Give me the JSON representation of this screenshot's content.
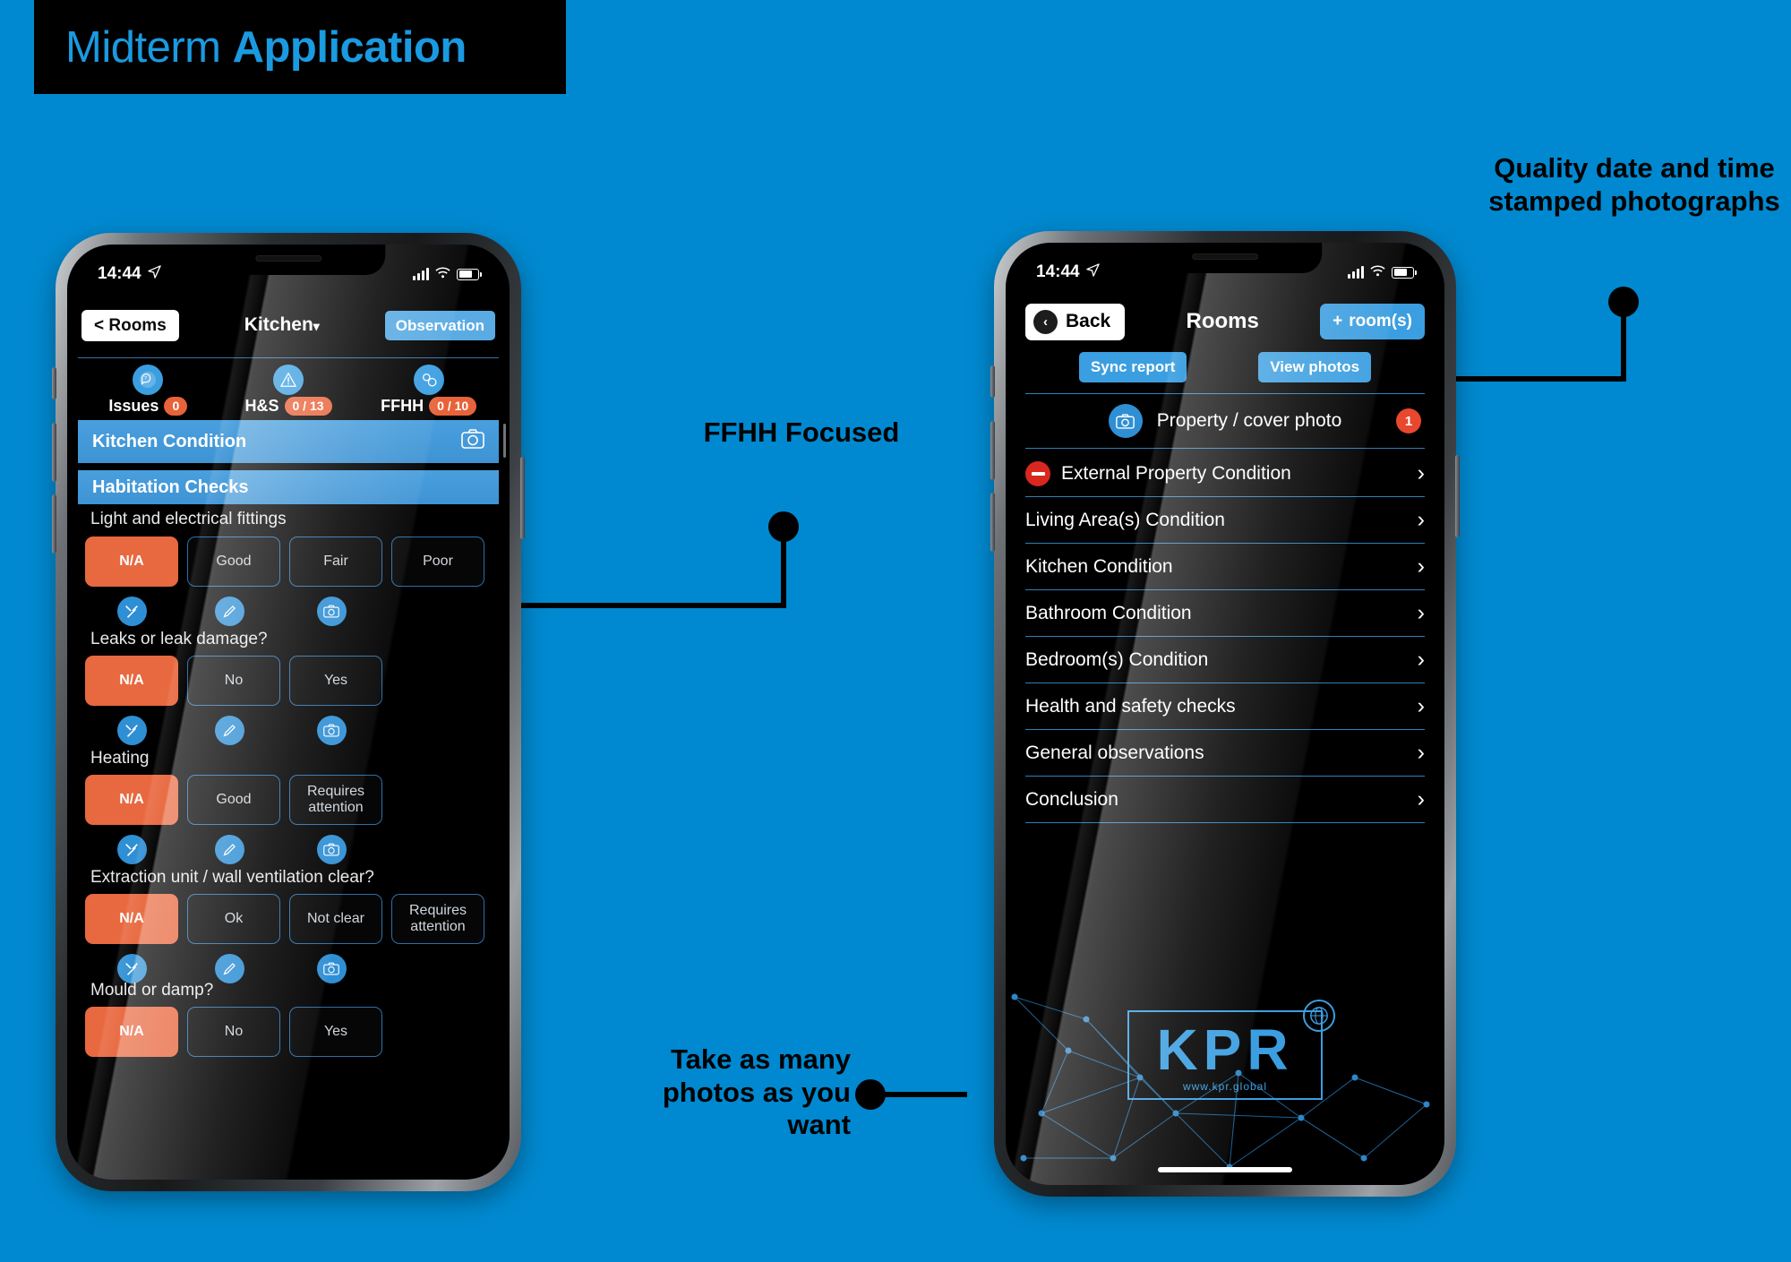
{
  "title": {
    "light": "Midterm ",
    "bold": "Application"
  },
  "annotations": [
    {
      "id": "quality-photos",
      "text": "Quality date and time stamped photographs"
    },
    {
      "id": "ffhh-focused",
      "text": "FFHH Focused"
    },
    {
      "id": "many-photos",
      "text": "Take as many photos as you want"
    }
  ],
  "left_phone": {
    "status": {
      "time": "14:44",
      "location_icon": "location-arrow-icon",
      "signal_icon": "signal-bars-icon",
      "wifi_icon": "wifi-icon",
      "battery_icon": "battery-icon"
    },
    "nav": {
      "back_label": "< Rooms",
      "title": "Kitchen",
      "caret": "▾",
      "action_label": "Observation"
    },
    "tabs": [
      {
        "icon": "issues-icon",
        "glyph": "?",
        "label": "Issues",
        "badge": "0"
      },
      {
        "icon": "warning-triangle-icon",
        "glyph": "⚠",
        "label": "H&S",
        "badge": "0 / 13"
      },
      {
        "icon": "settings-gear-icon",
        "glyph": "⚙",
        "label": "FFHH",
        "badge": "0 / 10"
      }
    ],
    "sections": [
      {
        "title": "Kitchen Condition",
        "camera_icon": "camera-icon"
      },
      {
        "title": "Habitation Checks",
        "camera_icon": ""
      }
    ],
    "questions": [
      {
        "label": "Light and electrical fittings",
        "options": [
          "N/A",
          "Good",
          "Fair",
          "Poor"
        ],
        "selected": 0,
        "icons": [
          "tools-icon",
          "pencil-icon",
          "camera-icon"
        ]
      },
      {
        "label": "Leaks or leak damage?",
        "options": [
          "N/A",
          "No",
          "Yes"
        ],
        "selected": 0,
        "icons": [
          "tools-icon",
          "pencil-icon",
          "camera-icon"
        ]
      },
      {
        "label": "Heating",
        "options": [
          "N/A",
          "Good",
          "Requires attention"
        ],
        "selected": 0,
        "icons": [
          "tools-icon",
          "pencil-icon",
          "camera-icon"
        ]
      },
      {
        "label": "Extraction unit / wall ventilation clear?",
        "options": [
          "N/A",
          "Ok",
          "Not clear",
          "Requires attention"
        ],
        "selected": 0,
        "icons": [
          "tools-icon",
          "pencil-icon",
          "camera-icon"
        ]
      },
      {
        "label": "Mould or damp?",
        "options": [
          "N/A",
          "No",
          "Yes"
        ],
        "selected": 0,
        "icons": []
      }
    ]
  },
  "right_phone": {
    "status": {
      "time": "14:44"
    },
    "nav": {
      "back_label": "Back",
      "title": "Rooms",
      "add_label": "room(s)",
      "add_plus": "+"
    },
    "sub_buttons": [
      "Sync report",
      "View photos"
    ],
    "cover": {
      "label": "Property / cover photo",
      "badge": "1",
      "camera_icon": "camera-icon"
    },
    "rooms": [
      {
        "label": "External Property Condition",
        "icon": "no-entry-icon"
      },
      {
        "label": "Living Area(s) Condition",
        "icon": ""
      },
      {
        "label": "Kitchen Condition",
        "icon": ""
      },
      {
        "label": "Bathroom Condition",
        "icon": ""
      },
      {
        "label": "Bedroom(s) Condition",
        "icon": ""
      },
      {
        "label": "Health and safety checks",
        "icon": ""
      },
      {
        "label": "General observations",
        "icon": ""
      },
      {
        "label": "Conclusion",
        "icon": ""
      }
    ],
    "logo": {
      "text": "KPR",
      "url": "www.kpr.global",
      "globe_icon": "globe-icon"
    }
  },
  "colors": {
    "background": "#0089d0",
    "accent_blue": "#3b9ee0",
    "orange": "#e8683f",
    "red": "#d9271f",
    "badge_red": "#e8482e"
  }
}
